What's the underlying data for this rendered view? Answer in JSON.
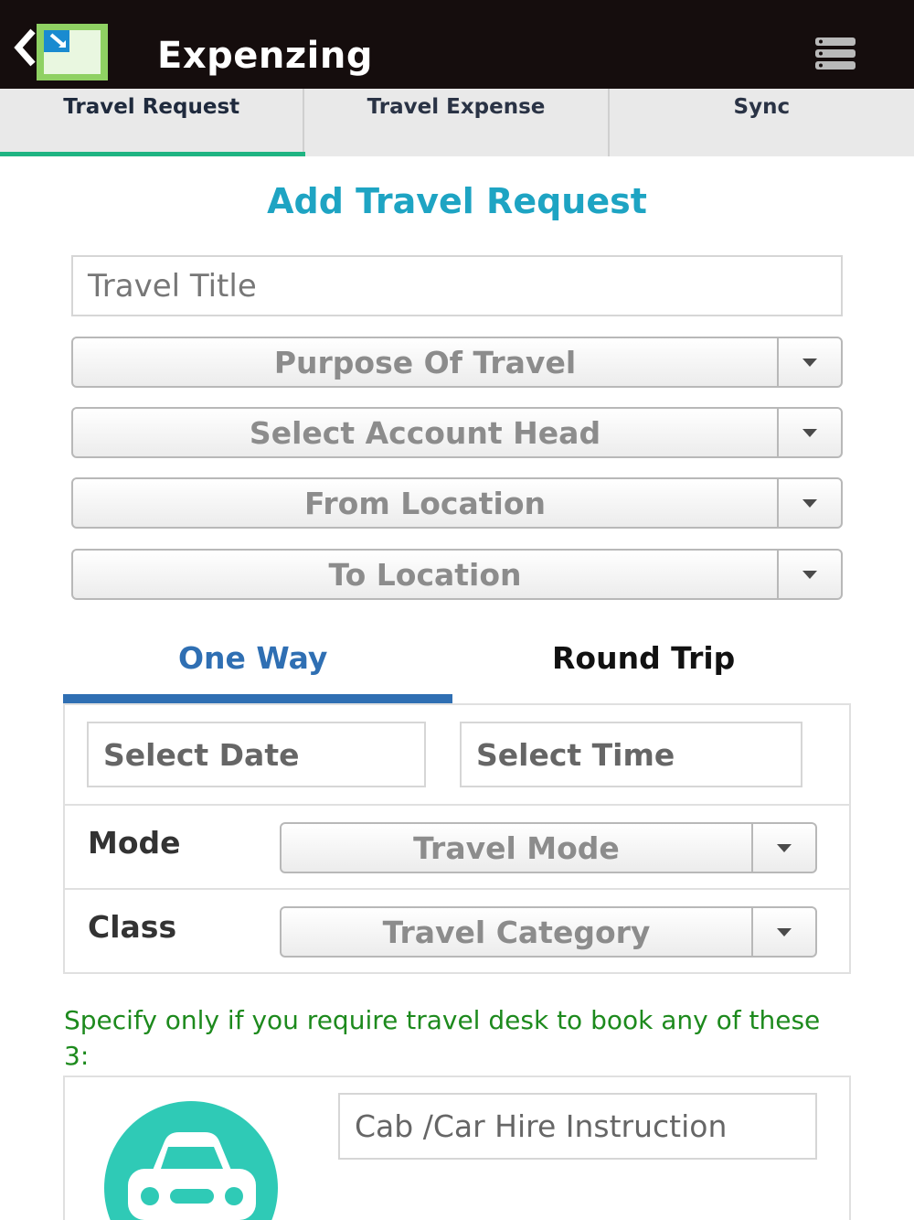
{
  "app": {
    "title": "Expenzing"
  },
  "tabs": [
    {
      "label": "Travel Request",
      "active": true
    },
    {
      "label": "Travel Expense",
      "active": false
    },
    {
      "label": "Sync",
      "active": false
    }
  ],
  "page": {
    "title": "Add Travel Request"
  },
  "form": {
    "travel_title_placeholder": "Travel Title",
    "purpose_select": "Purpose Of Travel",
    "account_head_select": "Select Account Head",
    "from_location_select": "From Location",
    "to_location_select": "To Location"
  },
  "trip_type": {
    "one_way": "One Way",
    "round_trip": "Round Trip",
    "selected": "One Way"
  },
  "journey": {
    "date_placeholder": "Select Date",
    "time_placeholder": "Select Time",
    "mode_label": "Mode",
    "mode_select": "Travel Mode",
    "class_label": "Class",
    "class_select": "Travel Category"
  },
  "booking": {
    "hint": "Specify only if you require travel desk to book any of these 3:",
    "cab_placeholder": "Cab /Car Hire Instruction",
    "cab_icon": "car-icon"
  },
  "colors": {
    "header_bg": "#150d0d",
    "active_tab_underline": "#1fb482",
    "title": "#1ea4c3",
    "trip_tab_active": "#2f6fb3",
    "hint": "#1d8a1d",
    "car_circle": "#2fcab6"
  }
}
